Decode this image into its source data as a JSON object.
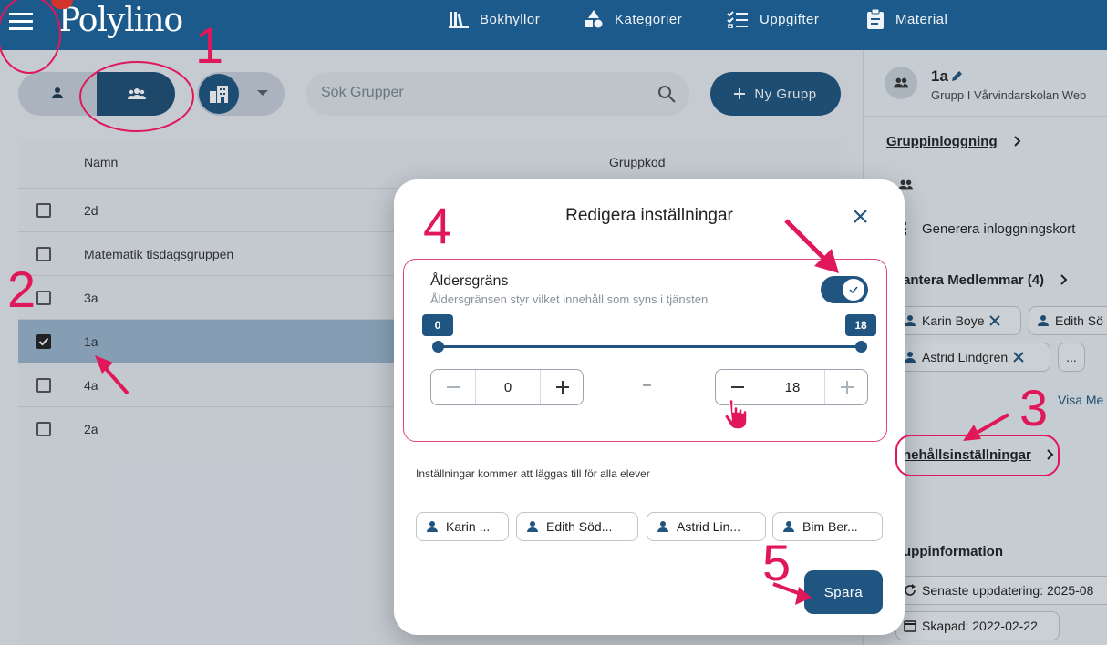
{
  "header": {
    "logo": "Polylino",
    "nav": [
      {
        "label": "Bokhyllor",
        "icon": "bookshelf-icon"
      },
      {
        "label": "Kategorier",
        "icon": "shapes-icon"
      },
      {
        "label": "Uppgifter",
        "icon": "checklist-icon"
      },
      {
        "label": "Material",
        "icon": "clipboard-icon"
      }
    ]
  },
  "toolbar": {
    "search_placeholder": "Sök Grupper",
    "new_group_label": "Ny Grupp"
  },
  "table": {
    "headers": {
      "name": "Namn",
      "code": "Gruppkod"
    },
    "rows": [
      {
        "name": "2d",
        "selected": false
      },
      {
        "name": "Matematik tisdagsgruppen",
        "selected": false
      },
      {
        "name": "3a",
        "selected": false
      },
      {
        "name": "1a",
        "selected": true
      },
      {
        "name": "4a",
        "selected": false
      },
      {
        "name": "2a",
        "selected": false
      }
    ]
  },
  "right_panel": {
    "title": "1a",
    "subtitle": "Grupp I Vårvindarskolan Web",
    "group_login": "Gruppinloggning",
    "generate_cards": "Generera inloggningskort",
    "members_title": "antera Medlemmar (4)",
    "members": [
      "Karin Boye",
      "Edith Sö",
      "Astrid Lindgren"
    ],
    "more": "...",
    "show_more": "Visa Me",
    "content_settings": "nehållsinställningar",
    "group_info": "uppinformation",
    "last_updated": "Senaste uppdatering: 2025-08",
    "created": "Skapad: 2022-02-22"
  },
  "dialog": {
    "title": "Redigera inställningar",
    "age_limit_label": "Åldersgräns",
    "age_limit_desc": "Åldersgränsen styr vilket innehåll som syns i tjänsten",
    "age_limit_enabled": true,
    "range": {
      "min": 0,
      "max": 18
    },
    "range_separator": "–",
    "info": "Inställningar kommer att läggas till för alla elever",
    "students": [
      "Karin ...",
      "Edith Söd...",
      "Astrid Lin...",
      "Bim Ber..."
    ],
    "save_label": "Spara"
  },
  "annotations": [
    "1",
    "2",
    "3",
    "4",
    "5"
  ],
  "colors": {
    "primary": "#1f5580",
    "header": "#1d5a8c",
    "annotation": "#e0185a"
  }
}
